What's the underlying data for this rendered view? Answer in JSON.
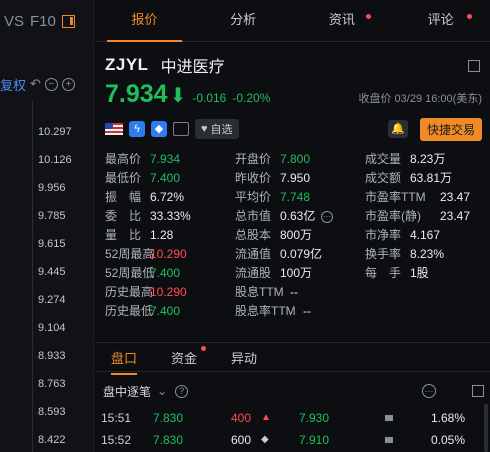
{
  "left": {
    "top_items": [
      "VS",
      "F10"
    ],
    "fq_label": "复权",
    "ticks": [
      "10.297",
      "10.126",
      "9.956",
      "9.785",
      "9.615",
      "9.445",
      "9.274",
      "9.104",
      "8.933",
      "8.763",
      "8.593",
      "8.422"
    ]
  },
  "tabs": [
    {
      "label": "报价",
      "dot": false
    },
    {
      "label": "分析",
      "dot": false
    },
    {
      "label": "资讯",
      "dot": true
    },
    {
      "label": "评论",
      "dot": true
    }
  ],
  "stock": {
    "code": "ZJYL",
    "name": "中进医疗",
    "price": "7.934",
    "arrow": "⬇",
    "change": "-0.016",
    "change_pct": "-0.20%",
    "close_info": "收盘价 03/29 16:00(美东)"
  },
  "actions": {
    "watch_label": "自选",
    "trade_label": "快捷交易"
  },
  "stats": {
    "col1": [
      {
        "label": "最高价",
        "value": "7.934",
        "color": "green"
      },
      {
        "label": "最低价",
        "value": "7.400",
        "color": "green"
      },
      {
        "label": "振　幅",
        "value": "6.72%",
        "color": "white"
      },
      {
        "label": "委　比",
        "value": "33.33%",
        "color": "white"
      },
      {
        "label": "量　比",
        "value": "1.28",
        "color": "white"
      },
      {
        "label": "52周最高",
        "value": "10.290",
        "color": "red"
      },
      {
        "label": "52周最低",
        "value": "7.400",
        "color": "green"
      },
      {
        "label": "历史最高",
        "value": "10.290",
        "color": "red"
      },
      {
        "label": "历史最低",
        "value": "7.400",
        "color": "green"
      }
    ],
    "col2": [
      {
        "label": "开盘价",
        "value": "7.800",
        "color": "green"
      },
      {
        "label": "昨收价",
        "value": "7.950",
        "color": "white"
      },
      {
        "label": "平均价",
        "value": "7.748",
        "color": "green"
      },
      {
        "label": "总市值",
        "value": "0.63亿",
        "color": "white"
      },
      {
        "label": "总股本",
        "value": "800万",
        "color": "white"
      },
      {
        "label": "流通值",
        "value": "0.079亿",
        "color": "white"
      },
      {
        "label": "流通股",
        "value": "100万",
        "color": "white"
      },
      {
        "label": "股息TTM",
        "value": "--",
        "color": "white"
      },
      {
        "label": "股息率TTM",
        "value": "--",
        "color": "white"
      }
    ],
    "col3": [
      {
        "label": "成交量",
        "value": "8.23万",
        "color": "white"
      },
      {
        "label": "成交额",
        "value": "63.81万",
        "color": "white"
      },
      {
        "label": "市盈率TTM",
        "value": "23.47",
        "color": "white"
      },
      {
        "label": "市盈率(静)",
        "value": "23.47",
        "color": "white"
      },
      {
        "label": "市净率",
        "value": "4.167",
        "color": "white"
      },
      {
        "label": "换手率",
        "value": "8.23%",
        "color": "white"
      },
      {
        "label": "每　手",
        "value": "1股",
        "color": "white"
      }
    ]
  },
  "bottom_tabs": [
    {
      "label": "盘口",
      "dot": false
    },
    {
      "label": "资金",
      "dot": true
    },
    {
      "label": "异动",
      "dot": false
    }
  ],
  "ticker": {
    "title": "盘中逐笔",
    "rows": [
      {
        "time": "15:51",
        "price": "7.830",
        "volume": "400",
        "marker": "▲",
        "price2": "7.930",
        "pct": "1.68%"
      },
      {
        "time": "15:52",
        "price": "7.830",
        "volume": "600",
        "marker": "◆",
        "price2": "7.910",
        "pct": "0.05%"
      }
    ]
  },
  "colors": {
    "accent": "#f08a24",
    "up": "#ff4d4d",
    "down": "#1fbf5c",
    "bg": "#0d0e12"
  }
}
